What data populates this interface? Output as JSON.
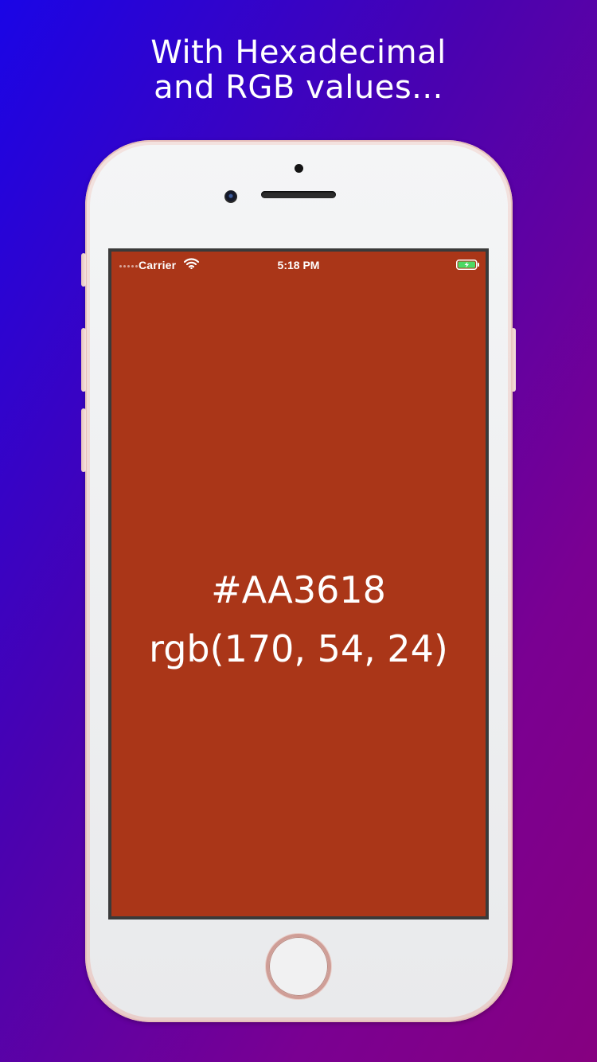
{
  "headline": {
    "line1": "With Hexadecimal",
    "line2": "and RGB values..."
  },
  "status_bar": {
    "carrier": "Carrier",
    "time": "5:18 PM",
    "icons": [
      "signal-dots-icon",
      "wifi-icon",
      "battery-charging-icon"
    ]
  },
  "color_display": {
    "hex": "#AA3618",
    "rgb": "rgb(170, 54, 24)",
    "background_color": "#aa3618"
  },
  "colors": {
    "gradient_start": "#1a05e6",
    "gradient_end": "#860080",
    "text": "#ffffff",
    "battery_fill": "#4cd964"
  }
}
